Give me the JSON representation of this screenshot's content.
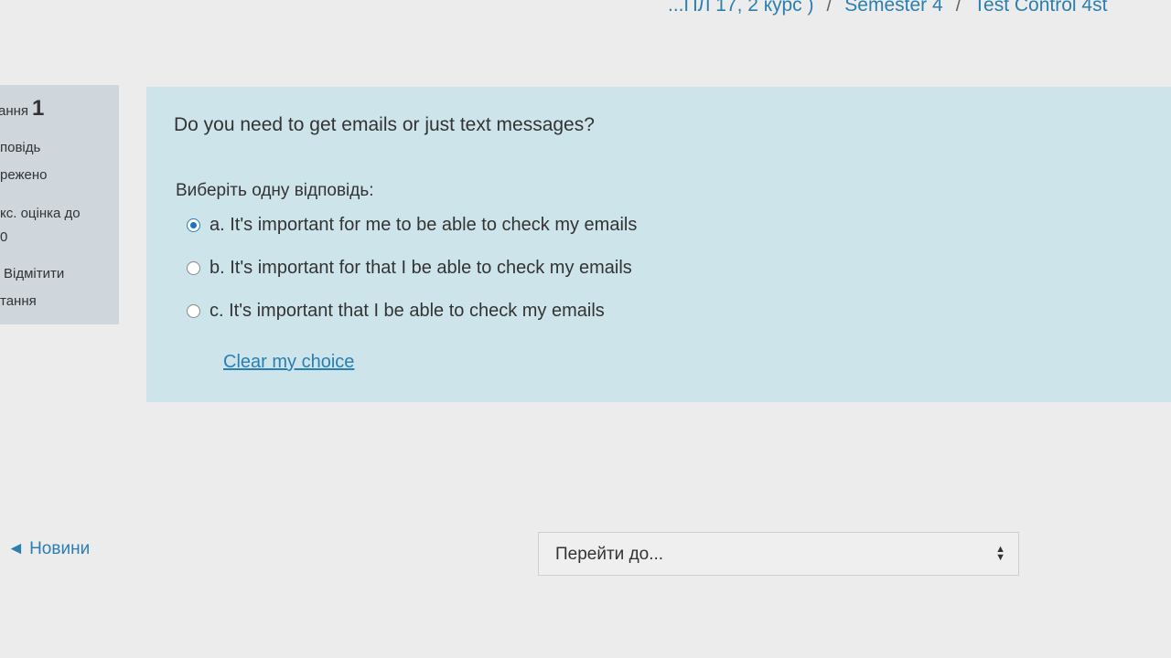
{
  "breadcrumb": {
    "items": [
      "...ПЛ 17, 2 курс )",
      "Semester 4",
      "Test Control 4st"
    ],
    "separator": "/"
  },
  "info": {
    "question_label": "ання",
    "question_number": "1",
    "status_line1": "повідь",
    "status_line2": "режено",
    "grade_line1": "кс. оцінка до",
    "grade_line2": "0",
    "flag_line1": "Відмітити",
    "flag_line2": "тання"
  },
  "question": {
    "text": "Do you need to get emails or just text messages?",
    "prompt": "Виберіть одну відповідь:",
    "options": [
      {
        "label": "a. It's important for me to be able to check my emails",
        "checked": true
      },
      {
        "label": "b. It's important for that I be able to check my emails",
        "checked": false
      },
      {
        "label": "c. It's important that I be able to check my emails",
        "checked": false
      }
    ],
    "clear_label": "Clear my choice"
  },
  "navigation": {
    "prev_link": "◄ Новини",
    "jump_placeholder": "Перейти до..."
  },
  "colors": {
    "panel_bg": "#cde5ea",
    "info_bg": "#cfd6dc",
    "link": "#2a7fb0",
    "radio_checked": "#1a73c8"
  }
}
